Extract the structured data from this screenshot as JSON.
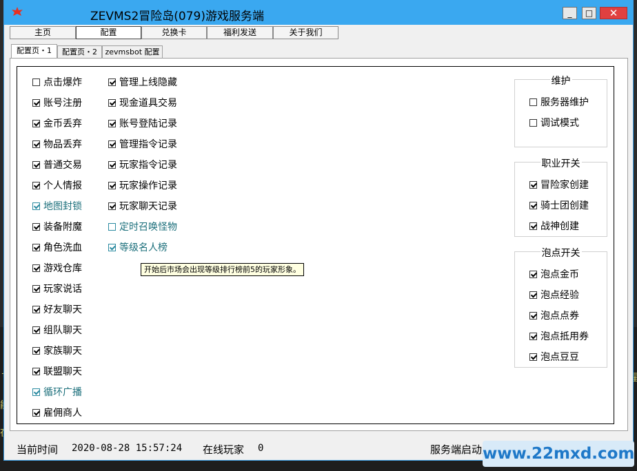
{
  "window": {
    "title": "ZEVMS2冒险岛(079)游戏服务端",
    "minimize": "_",
    "maximize": "□",
    "close": "✕"
  },
  "main_tabs": [
    {
      "label": "主页"
    },
    {
      "label": "配置"
    },
    {
      "label": "兑换卡"
    },
    {
      "label": "福利发送"
    },
    {
      "label": "关于我们"
    }
  ],
  "sub_tabs": [
    {
      "label": "配置页・1"
    },
    {
      "label": "配置页・2"
    },
    {
      "label": "zevmsbot 配置"
    }
  ],
  "col1": [
    {
      "label": "点击爆炸",
      "checked": false,
      "teal": false
    },
    {
      "label": "账号注册",
      "checked": true,
      "teal": false
    },
    {
      "label": "金币丢弃",
      "checked": true,
      "teal": false
    },
    {
      "label": "物品丢弃",
      "checked": true,
      "teal": false
    },
    {
      "label": "普通交易",
      "checked": true,
      "teal": false
    },
    {
      "label": "个人情报",
      "checked": true,
      "teal": false
    },
    {
      "label": "地图封锁",
      "checked": true,
      "teal": true
    },
    {
      "label": "装备附魔",
      "checked": true,
      "teal": false
    },
    {
      "label": "角色洗血",
      "checked": true,
      "teal": false
    },
    {
      "label": "游戏仓库",
      "checked": true,
      "teal": false
    },
    {
      "label": "玩家说话",
      "checked": true,
      "teal": false
    },
    {
      "label": "好友聊天",
      "checked": true,
      "teal": false
    },
    {
      "label": "组队聊天",
      "checked": true,
      "teal": false
    },
    {
      "label": "家族聊天",
      "checked": true,
      "teal": false
    },
    {
      "label": "联盟聊天",
      "checked": true,
      "teal": false
    },
    {
      "label": "循环广播",
      "checked": true,
      "teal": true
    },
    {
      "label": "雇佣商人",
      "checked": true,
      "teal": false
    }
  ],
  "col2": [
    {
      "label": "管理上线隐藏",
      "checked": true,
      "teal": false
    },
    {
      "label": "现金道具交易",
      "checked": true,
      "teal": false
    },
    {
      "label": "账号登陆记录",
      "checked": true,
      "teal": false
    },
    {
      "label": "管理指令记录",
      "checked": true,
      "teal": false
    },
    {
      "label": "玩家指令记录",
      "checked": true,
      "teal": false
    },
    {
      "label": "玩家操作记录",
      "checked": true,
      "teal": false
    },
    {
      "label": "玩家聊天记录",
      "checked": true,
      "teal": false
    },
    {
      "label": "定时召唤怪物",
      "checked": false,
      "teal": true
    },
    {
      "label": "等级名人榜",
      "checked": true,
      "teal": true
    }
  ],
  "tooltip": "开始后市场会出现等级排行榜前5的玩家形象。",
  "groups": [
    {
      "title": "维护",
      "items": [
        {
          "label": "服务器维护",
          "checked": false
        },
        {
          "label": "调试模式",
          "checked": false
        }
      ]
    },
    {
      "title": "职业开关",
      "items": [
        {
          "label": "冒险家创建",
          "checked": true
        },
        {
          "label": "骑士团创建",
          "checked": true
        },
        {
          "label": "战神创建",
          "checked": true
        }
      ]
    },
    {
      "title": "泡点开关",
      "items": [
        {
          "label": "泡点金币",
          "checked": true
        },
        {
          "label": "泡点经验",
          "checked": true
        },
        {
          "label": "泡点点券",
          "checked": true
        },
        {
          "label": "泡点抵用券",
          "checked": true
        },
        {
          "label": "泡点豆豆",
          "checked": true
        }
      ]
    }
  ],
  "status": {
    "time_label": "当前时间",
    "time_value": "2020-08-28 15:57:24",
    "online_label": "在线玩家",
    "online_value": "0",
    "server_status": "服务端启动成功"
  },
  "watermark": "www.22mxd.com",
  "background_console": {
    "frag1": "t",
    "frag2": "能",
    "frag3": "在",
    "frag4": "星"
  }
}
